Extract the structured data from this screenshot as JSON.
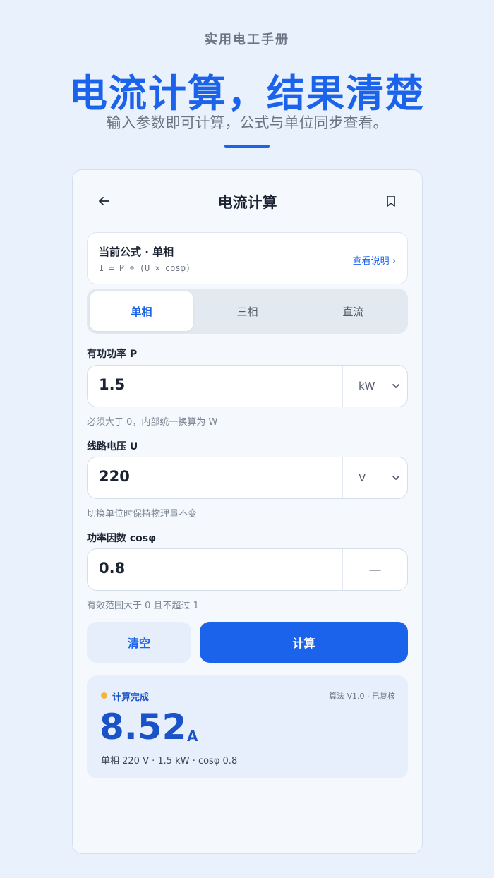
{
  "hero": {
    "eyebrow": "实用电工手册",
    "title": "电流计算，结果清楚",
    "subtitle": "输入参数即可计算，公式与单位同步查看。"
  },
  "app": {
    "title": "电流计算",
    "back_icon": "arrow-left-icon",
    "bookmark_icon": "bookmark-icon"
  },
  "formula": {
    "title": "当前公式 · 单相",
    "expression": "I = P ÷ (U × cosφ)",
    "link": "查看说明 ›"
  },
  "phase_tabs": [
    {
      "label": "单相",
      "active": true
    },
    {
      "label": "三相",
      "active": false
    },
    {
      "label": "直流",
      "active": false
    }
  ],
  "fields": {
    "power": {
      "label": "有功功率 P",
      "value": "1.5",
      "unit": "kW",
      "hint": "必须大于 0，内部统一换算为 W"
    },
    "voltage": {
      "label": "线路电压 U",
      "value": "220",
      "unit": "V",
      "hint": "切换单位时保持物理量不变"
    },
    "pf": {
      "label": "功率因数 cosφ",
      "value": "0.8",
      "unit": "—",
      "hint": "有效范围大于 0 且不超过 1"
    }
  },
  "actions": {
    "clear": "清空",
    "calculate": "计算"
  },
  "result": {
    "status": "计算完成",
    "meta": "算法 V1.0 · 已复核",
    "value": "8.52",
    "unit": "A",
    "detail": "单相 220 V · 1.5 kW · cosφ 0.8",
    "status_color": "#f5b43d"
  },
  "colors": {
    "accent": "#1a63ea",
    "background": "#e9f1fc"
  }
}
